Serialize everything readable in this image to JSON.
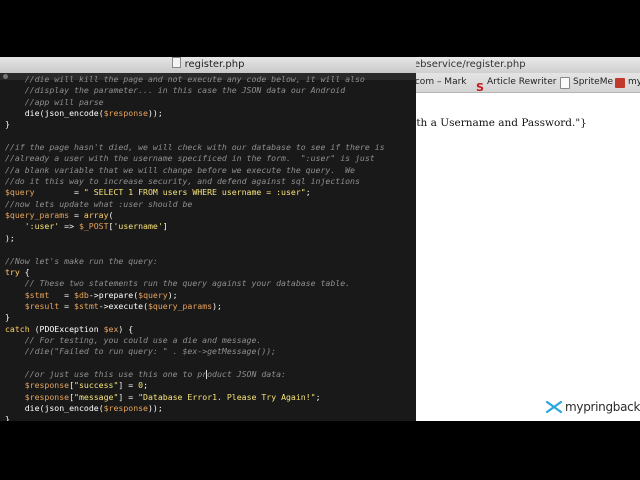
{
  "browser": {
    "address": "ebservice/register.php",
    "bookmarks": [
      {
        "label": ".com – Mark",
        "icon": "page-icon"
      },
      {
        "label": "Article Rewriter",
        "icon": "s-logo-icon"
      },
      {
        "label": "SpriteMe",
        "icon": "document-icon"
      },
      {
        "label": "my",
        "icon": "my-logo-icon"
      }
    ],
    "page_text": "oth a Username and Password.\"}",
    "brand": "mypringback"
  },
  "editor": {
    "title": "register.php",
    "lines": [
      [
        [
          "cm",
          "    //die will kill the page and not execute any code below, it will also"
        ]
      ],
      [
        [
          "cm",
          "    //display the parameter... in this case the JSON data our Android"
        ]
      ],
      [
        [
          "cm",
          "    //app will parse"
        ]
      ],
      [
        [
          "op",
          "    "
        ],
        [
          "fn",
          "die"
        ],
        [
          "op",
          "("
        ],
        [
          "fn",
          "json_encode"
        ],
        [
          "op",
          "("
        ],
        [
          "var",
          "$response"
        ],
        [
          "op",
          "));"
        ]
      ],
      [
        [
          "op",
          "}"
        ]
      ],
      [
        [
          "op",
          ""
        ]
      ],
      [
        [
          "cm",
          "//if the page hasn't died, we will check with our database to see if there is"
        ]
      ],
      [
        [
          "cm",
          "//already a user with the username specificed in the form.  \":user\" is just"
        ]
      ],
      [
        [
          "cm",
          "//a blank variable that we will change before we execute the query.  We"
        ]
      ],
      [
        [
          "cm",
          "//do it this way to increase security, and defend against sql injections"
        ]
      ],
      [
        [
          "var",
          "$query"
        ],
        [
          "op",
          "        = "
        ],
        [
          "str",
          "\" SELECT 1 FROM users WHERE username = :user\""
        ],
        [
          "op",
          ";"
        ]
      ],
      [
        [
          "cm",
          "//now lets update what :user should be"
        ]
      ],
      [
        [
          "var",
          "$query_params"
        ],
        [
          "op",
          " = "
        ],
        [
          "kw",
          "array"
        ],
        [
          "op",
          "("
        ]
      ],
      [
        [
          "op",
          "    "
        ],
        [
          "str",
          "':user'"
        ],
        [
          "op",
          " => "
        ],
        [
          "var",
          "$_POST"
        ],
        [
          "op",
          "["
        ],
        [
          "str",
          "'username'"
        ],
        [
          "op",
          "]"
        ]
      ],
      [
        [
          "op",
          ");"
        ]
      ],
      [
        [
          "op",
          ""
        ]
      ],
      [
        [
          "cm",
          "//Now let's make run the query:"
        ]
      ],
      [
        [
          "kw",
          "try"
        ],
        [
          "op",
          " {"
        ]
      ],
      [
        [
          "cm",
          "    // These two statements run the query against your database table."
        ]
      ],
      [
        [
          "op",
          "    "
        ],
        [
          "var",
          "$stmt"
        ],
        [
          "op",
          "   = "
        ],
        [
          "var",
          "$db"
        ],
        [
          "op",
          "->"
        ],
        [
          "fn",
          "prepare"
        ],
        [
          "op",
          "("
        ],
        [
          "var",
          "$query"
        ],
        [
          "op",
          ");"
        ]
      ],
      [
        [
          "op",
          "    "
        ],
        [
          "var",
          "$result"
        ],
        [
          "op",
          " = "
        ],
        [
          "var",
          "$stmt"
        ],
        [
          "op",
          "->"
        ],
        [
          "fn",
          "execute"
        ],
        [
          "op",
          "("
        ],
        [
          "var",
          "$query_params"
        ],
        [
          "op",
          ");"
        ]
      ],
      [
        [
          "op",
          "}"
        ]
      ],
      [
        [
          "kw",
          "catch"
        ],
        [
          "op",
          " ("
        ],
        [
          "fn",
          "PDOException"
        ],
        [
          "op",
          " "
        ],
        [
          "var",
          "$ex"
        ],
        [
          "op",
          ") {"
        ]
      ],
      [
        [
          "cm",
          "    // For testing, you could use a die and message."
        ]
      ],
      [
        [
          "cm",
          "    //die(\"Failed to run query: \" . $ex->getMessage());"
        ]
      ],
      [
        [
          "op",
          ""
        ]
      ],
      [
        [
          "cm",
          "    //or just use this use this one to product JSON data:"
        ]
      ],
      [
        [
          "op",
          "    "
        ],
        [
          "var",
          "$response"
        ],
        [
          "op",
          "["
        ],
        [
          "str",
          "\"success\""
        ],
        [
          "op",
          "] = "
        ],
        [
          "str",
          "0"
        ],
        [
          "op",
          ";"
        ]
      ],
      [
        [
          "op",
          "    "
        ],
        [
          "var",
          "$response"
        ],
        [
          "op",
          "["
        ],
        [
          "str",
          "\"message\""
        ],
        [
          "op",
          "] = "
        ],
        [
          "str",
          "\"Database Error1. Please Try Again!\""
        ],
        [
          "op",
          ";"
        ]
      ],
      [
        [
          "op",
          "    "
        ],
        [
          "fn",
          "die"
        ],
        [
          "op",
          "("
        ],
        [
          "fn",
          "json_encode"
        ],
        [
          "op",
          "("
        ],
        [
          "var",
          "$response"
        ],
        [
          "op",
          "));"
        ]
      ],
      [
        [
          "op",
          "}"
        ]
      ]
    ]
  },
  "colors": {
    "editor_bg": "#191919",
    "comment": "#8f8f8f",
    "keyword": "#ffcc66",
    "string": "#f6e27a",
    "variable": "#e6a35c"
  }
}
